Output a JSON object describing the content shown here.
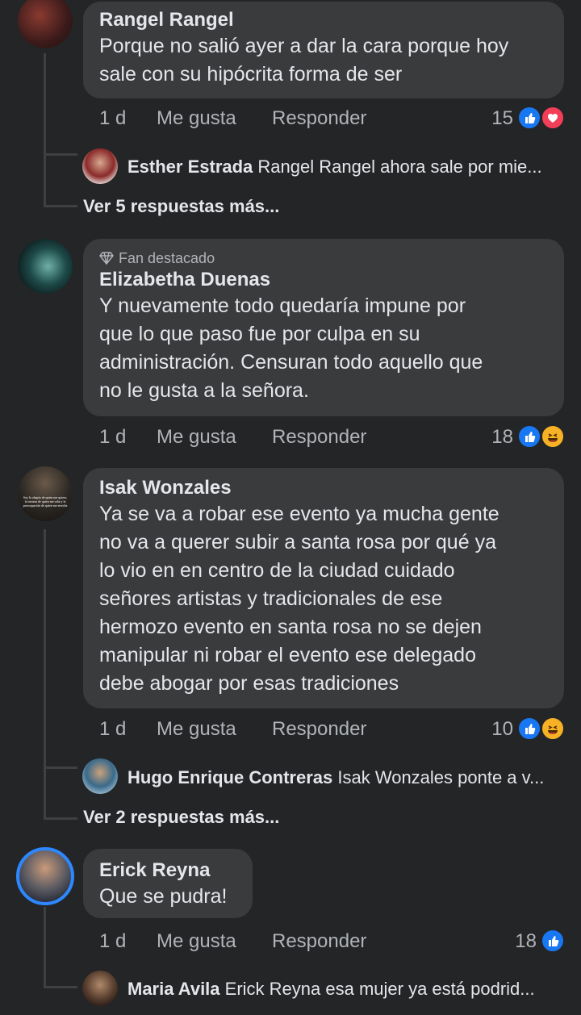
{
  "comments": [
    {
      "author": "Rangel Rangel",
      "text": "Porque no salió ayer a dar la cara porque hoy\nsale con su hipócrita forma de ser",
      "time": "1 d",
      "like": "Me gusta",
      "reply": "Responder",
      "count": "15",
      "reactions": [
        "like",
        "heart"
      ],
      "reply_preview": {
        "author": "Esther Estrada",
        "text": "Rangel Rangel ahora sale por mie..."
      },
      "more_replies": "Ver 5 respuestas más..."
    },
    {
      "badge": "Fan destacado",
      "author": "Elizabetha Duenas",
      "text": "Y nuevamente todo quedaría impune por\nque lo que paso fue por culpa en su\nadministración. Censuran todo aquello que\nno le gusta a la señora.",
      "time": "1 d",
      "like": "Me gusta",
      "reply": "Responder",
      "count": "18",
      "reactions": [
        "like",
        "haha"
      ]
    },
    {
      "author": "Isak Wonzales",
      "avatar_text": "Soy la alegría de quien me quiere, la tristeza de quien me odia y la preocupación de quien me envidia",
      "text": "Ya se va a robar ese evento ya mucha gente\nno va a querer subir a santa rosa por qué ya\nlo vio en en centro de la ciudad cuidado\nseñores artistas y tradicionales de ese\nhermozo evento en santa rosa no se dejen\nmanipular ni robar el evento ese delegado\ndebe abogar por esas tradiciones",
      "time": "1 d",
      "like": "Me gusta",
      "reply": "Responder",
      "count": "10",
      "reactions": [
        "like",
        "haha"
      ],
      "reply_preview": {
        "author": "Hugo Enrique Contreras",
        "text": "Isak Wonzales ponte a v..."
      },
      "more_replies": "Ver 2 respuestas más..."
    },
    {
      "author": "Erick Reyna",
      "text": "Que se pudra!",
      "time": "1 d",
      "like": "Me gusta",
      "reply": "Responder",
      "count": "18",
      "reactions": [
        "like"
      ],
      "reply_preview": {
        "author": "Maria Avila",
        "text": "Erick Reyna esa mujer ya está podrid..."
      }
    }
  ],
  "colors": {
    "background": "#242526",
    "bubble": "#3a3b3c",
    "like": "#1877f2",
    "heart": "#f33e58",
    "haha": "#f7b125",
    "story_ring": "#2d88ff"
  }
}
